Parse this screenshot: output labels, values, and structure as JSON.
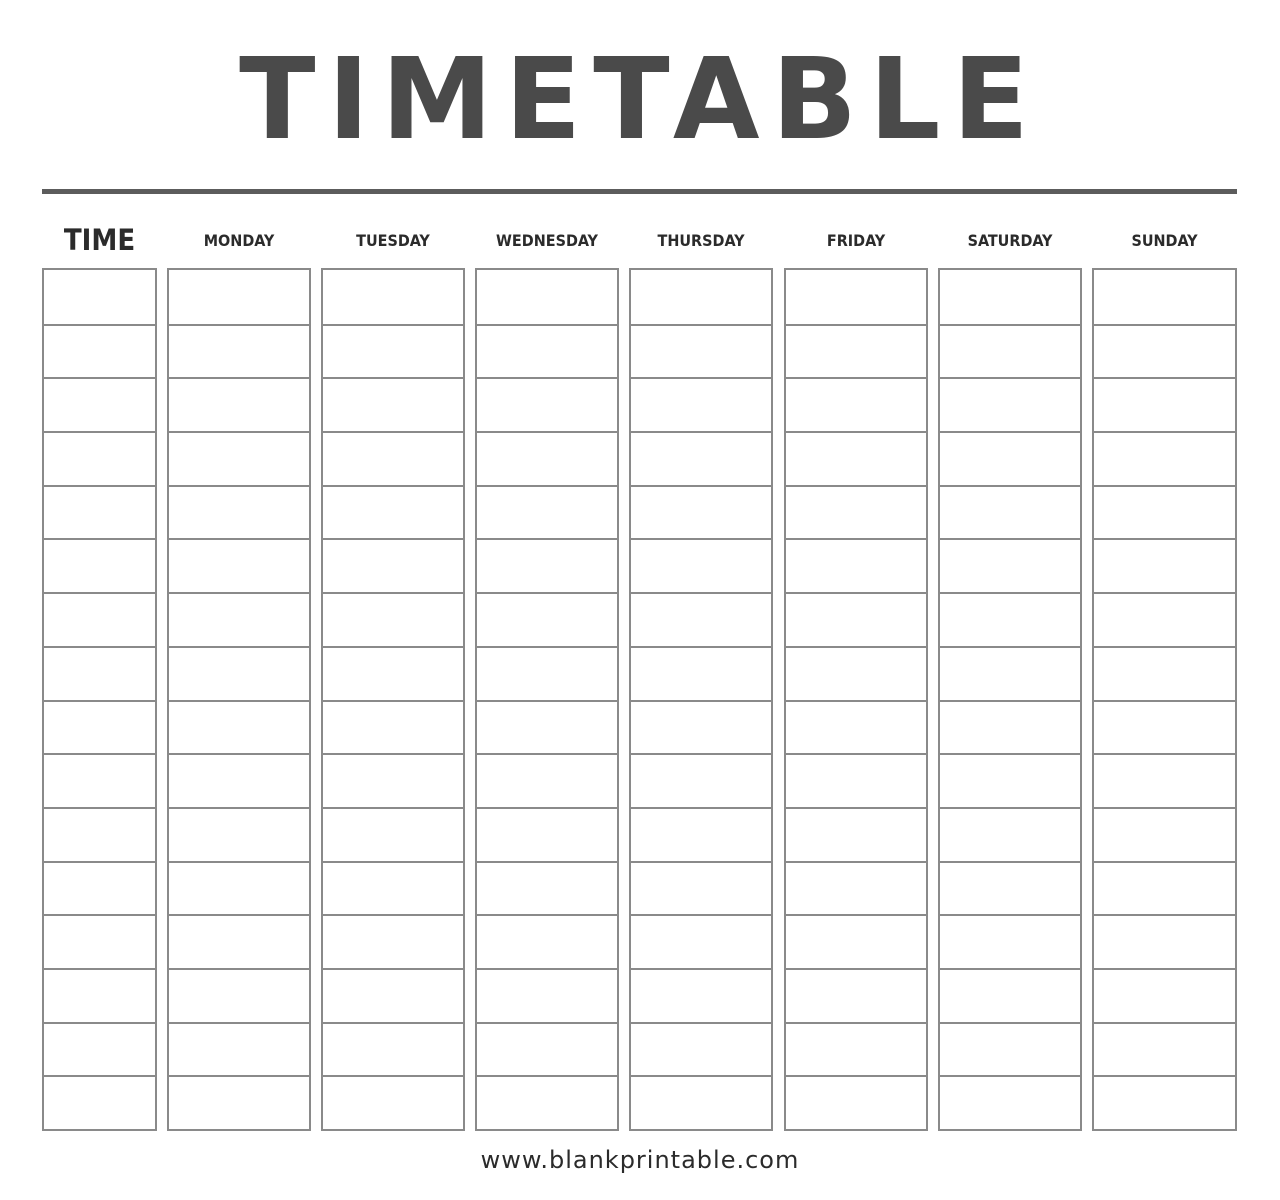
{
  "title": "TIMETABLE",
  "columns": [
    {
      "label": "TIME",
      "key": "time"
    },
    {
      "label": "MONDAY",
      "key": "monday"
    },
    {
      "label": "TUESDAY",
      "key": "tuesday"
    },
    {
      "label": "WEDNESDAY",
      "key": "wednesday"
    },
    {
      "label": "THURSDAY",
      "key": "thursday"
    },
    {
      "label": "FRIDAY",
      "key": "friday"
    },
    {
      "label": "SATURDAY",
      "key": "saturday"
    },
    {
      "label": "SUNDAY",
      "key": "sunday"
    }
  ],
  "rows_per_column": 16,
  "footer": {
    "url": "www.blankprintable.com"
  },
  "colors": {
    "title": "#4a4a4a",
    "rule": "#5c5c5c",
    "grid": "#8a8a8a",
    "text": "#2b2b2b"
  }
}
